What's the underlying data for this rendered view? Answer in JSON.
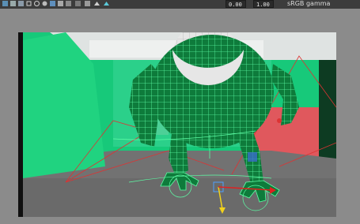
{
  "toolbar": {
    "field_1": "0.00",
    "field_2": "1.00",
    "gamma_label": "sRGB gamma",
    "icons": [
      "grid-icon",
      "film-gate-icon",
      "resolution-gate-icon",
      "safe-action-icon",
      "wireframe-icon",
      "smooth-shade-icon",
      "textured-icon",
      "lights-icon",
      "shadows-icon",
      "xray-icon",
      "isolate-icon",
      "exposure-icon",
      "gamma-icon"
    ]
  },
  "viewport": {
    "scene_description_colors": {
      "greenscreen": "#1fd27d",
      "red_wall": "#e4545a",
      "floor": "#686868",
      "wireframe": "#58ff9f",
      "dark_body": "#0f7a3c",
      "eye_white": "#e8e8e8"
    }
  }
}
